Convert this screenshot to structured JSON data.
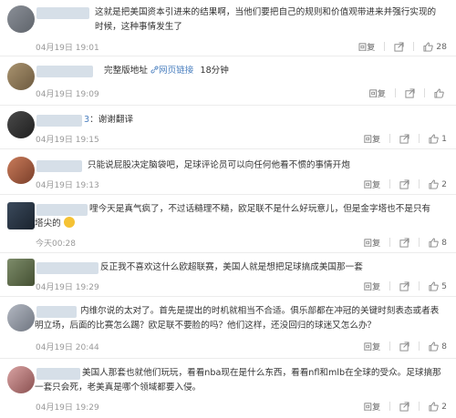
{
  "actions": {
    "reply": "回复"
  },
  "comments": [
    {
      "text": "这就是把美国资本引进来的结果啊，当他们要把自己的规则和价值观带进来并强行实现的时候，这种事情发生了",
      "time": "04月19日 19:01",
      "likes": "28"
    },
    {
      "text_pre": "完整版地址",
      "link_label": "网页链接",
      "text_post": "18分钟",
      "time": "04月19日 19:09",
      "likes": ""
    },
    {
      "name_suffix": "3",
      "text": "：谢谢翻译",
      "time": "04月19日 19:15",
      "likes": "1"
    },
    {
      "text": "只能说屁股决定脑袋吧，足球评论员可以向任何他看不惯的事情开炮",
      "time": "04月19日 19:13",
      "likes": "2"
    },
    {
      "text": "哩今天是真气疯了，不过话糙理不糙，欧足联不是什么好玩意儿，但是金字塔也不是只有塔尖的",
      "time": "今天00:28",
      "likes": "8"
    },
    {
      "text": "反正我不喜欢这什么欧超联赛，美国人就是想把足球搞成美国那一套",
      "time": "04月19日 19:29",
      "likes": "5"
    },
    {
      "text": "内维尔说的太对了。首先是提出的时机就相当不合适。俱乐部都在冲冠的关键时刻表态或者表明立场，后面的比赛怎么踢？欧足联不要脸的吗？他们这样，还没回归的球迷又怎么办？",
      "time": "04月19日 20:44",
      "likes": "8"
    },
    {
      "text": "美国人那套也就他们玩玩，看看nba现在是什么东西，看看nfl和mlb在全球的受众。足球搞那一套只会死，老美真是哪个领域都要入侵。",
      "time": "04月19日 19:29",
      "likes": "2"
    }
  ]
}
